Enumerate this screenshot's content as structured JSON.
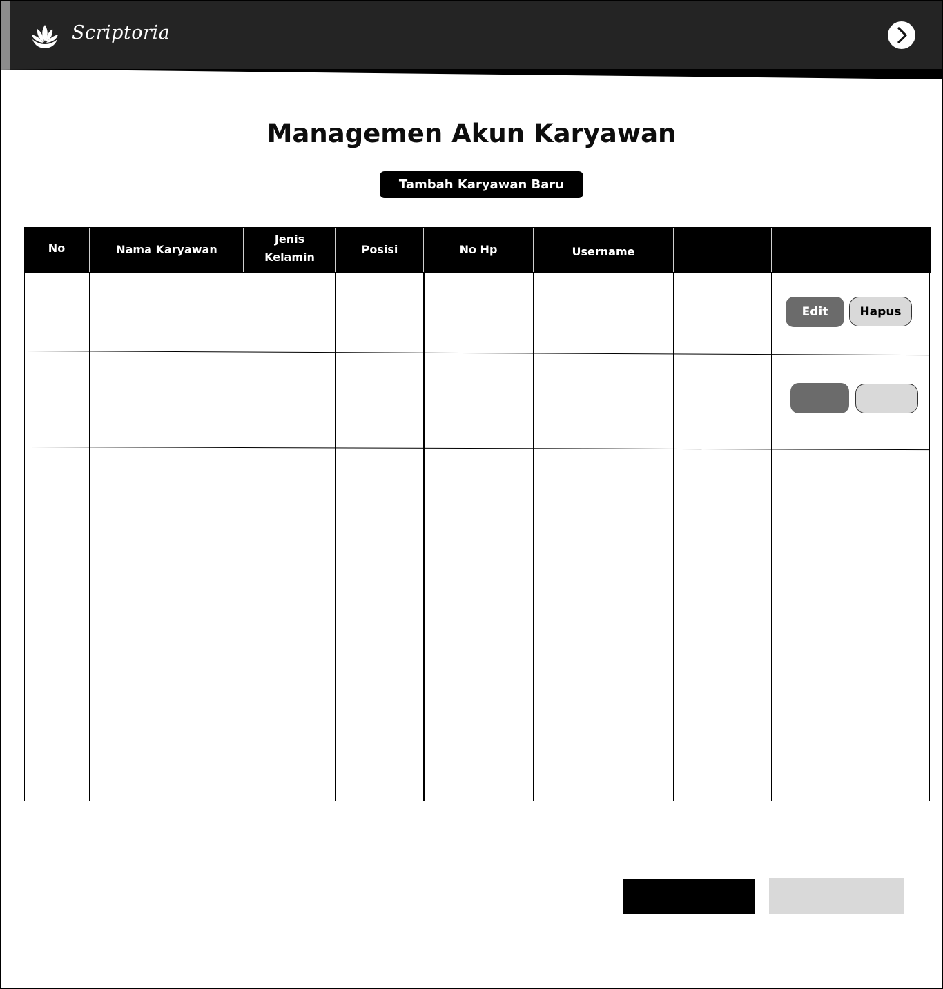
{
  "app": {
    "brand": "Scriptoria",
    "logo_icon": "lotus-icon",
    "next_icon": "chevron-right-icon"
  },
  "page": {
    "title": "Managemen Akun Karyawan",
    "add_button_label": "Tambah Karyawan Baru"
  },
  "table": {
    "columns": [
      "No",
      "Nama Karyawan",
      "Jenis Kelamin",
      "Posisi",
      "No Hp",
      "Username",
      "",
      ""
    ],
    "column_jenis_line1": "Jenis",
    "column_jenis_line2": "Kelamin",
    "rows": [
      {
        "cells": [
          "",
          "",
          "",
          "",
          "",
          "",
          ""
        ],
        "edit_label": "Edit",
        "delete_label": "Hapus"
      },
      {
        "cells": [
          "",
          "",
          "",
          "",
          "",
          "",
          ""
        ],
        "edit_label": "",
        "delete_label": ""
      }
    ]
  },
  "footer": {
    "primary_label": "",
    "secondary_label": ""
  },
  "colors": {
    "header_bg": "#242424",
    "primary": "#000000",
    "edit_button": "#6b6b6b",
    "delete_button": "#d9d9d9"
  }
}
